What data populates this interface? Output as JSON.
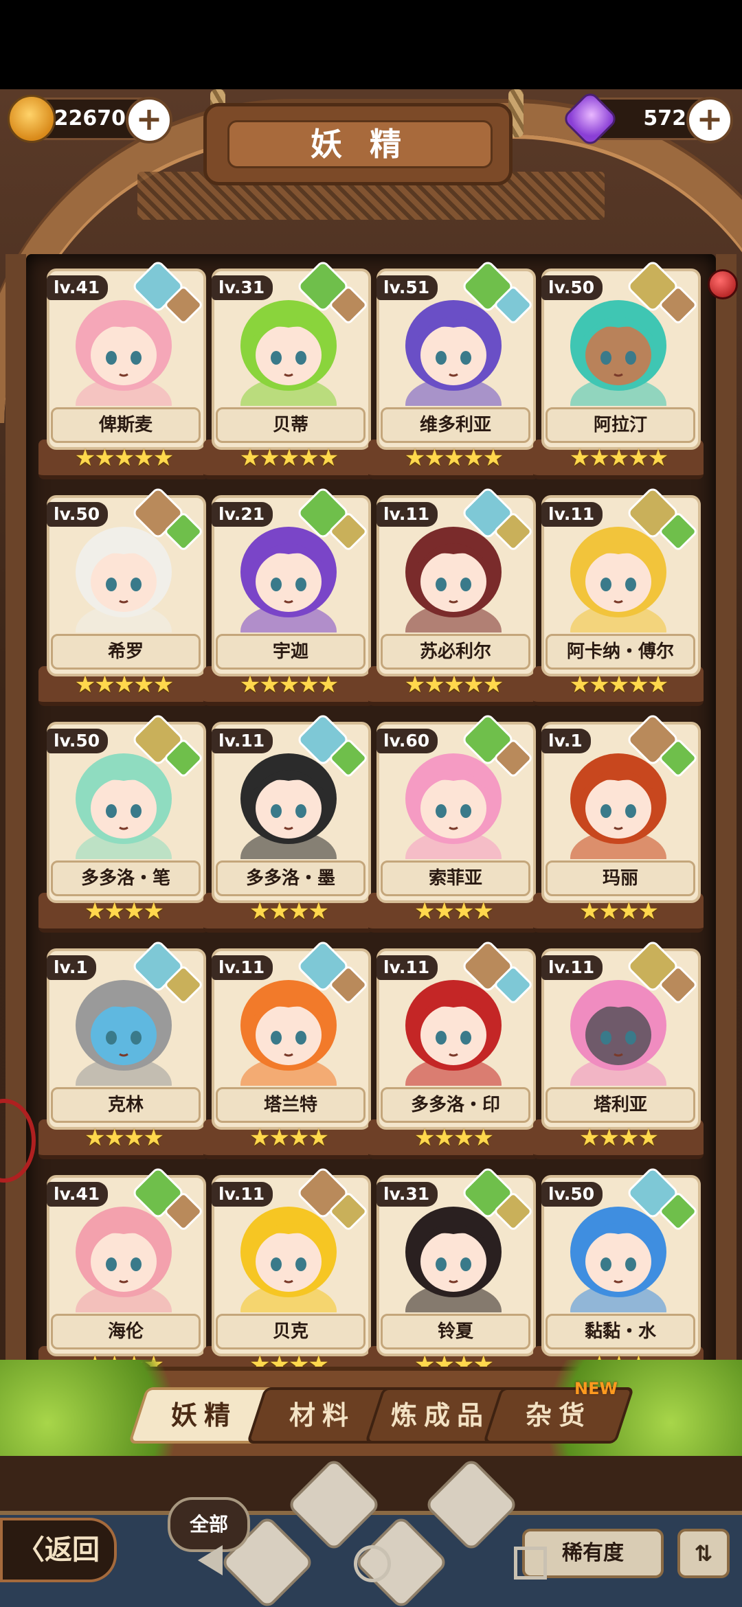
{
  "header": {
    "title": "妖 精",
    "coins": {
      "amount": "22670",
      "icon": "crown-coin-icon",
      "plus": "+"
    },
    "gems": {
      "amount": "572",
      "icon": "purple-gem-icon",
      "plus": "+"
    }
  },
  "elements": {
    "water": {
      "color": "#7ec8d6",
      "icon": "water-drop-icon"
    },
    "earth": {
      "color": "#b98a5b",
      "icon": "mountain-icon"
    },
    "plant": {
      "color": "#6fbf4b",
      "icon": "sprout-icon"
    },
    "sand": {
      "color": "#c9b05a",
      "icon": "pyramid-icon"
    }
  },
  "fairies": [
    {
      "lv": "lv.41",
      "name": "俾斯麦",
      "stars": "★★★★★",
      "e1": "water",
      "e2": "earth",
      "hair": "#f5a7b8",
      "skin": "#fde4d6"
    },
    {
      "lv": "lv.31",
      "name": "贝蒂",
      "stars": "★★★★★",
      "e1": "plant",
      "e2": "earth",
      "hair": "#8ad43c",
      "skin": "#fde4d6"
    },
    {
      "lv": "lv.51",
      "name": "维多利亚",
      "stars": "★★★★★",
      "e1": "plant",
      "e2": "water",
      "hair": "#6a4fc6",
      "skin": "#fde4d6"
    },
    {
      "lv": "lv.50",
      "name": "阿拉汀",
      "stars": "★★★★★",
      "e1": "sand",
      "e2": "earth",
      "hair": "#3fc6b3",
      "skin": "#b9825a"
    },
    {
      "lv": "lv.50",
      "name": "希罗",
      "stars": "★★★★★",
      "e1": "earth",
      "e2": "plant",
      "hair": "#f1efe9",
      "skin": "#fde4d6"
    },
    {
      "lv": "lv.21",
      "name": "宇迦",
      "stars": "★★★★★",
      "e1": "plant",
      "e2": "sand",
      "hair": "#7a45c8",
      "skin": "#fde4d6"
    },
    {
      "lv": "lv.11",
      "name": "苏必利尔",
      "stars": "★★★★★",
      "e1": "water",
      "e2": "sand",
      "hair": "#7a2b2b",
      "skin": "#fde4d6"
    },
    {
      "lv": "lv.11",
      "name": "阿卡纳・傅尔",
      "stars": "★★★★★",
      "e1": "sand",
      "e2": "plant",
      "hair": "#f2c43b",
      "skin": "#fde4d6"
    },
    {
      "lv": "lv.50",
      "name": "多多洛・笔",
      "stars": "★★★★",
      "e1": "sand",
      "e2": "plant",
      "hair": "#8fdcc0",
      "skin": "#fde4d6"
    },
    {
      "lv": "lv.11",
      "name": "多多洛・墨",
      "stars": "★★★★",
      "e1": "water",
      "e2": "plant",
      "hair": "#2b2b2b",
      "skin": "#fde4d6"
    },
    {
      "lv": "lv.60",
      "name": "索菲亚",
      "stars": "★★★★",
      "e1": "plant",
      "e2": "earth",
      "hair": "#f59bc3",
      "skin": "#fde4d6"
    },
    {
      "lv": "lv.1",
      "name": "玛丽",
      "stars": "★★★★",
      "e1": "earth",
      "e2": "plant",
      "hair": "#c8471e",
      "skin": "#fde4d6"
    },
    {
      "lv": "lv.1",
      "name": "克林",
      "stars": "★★★★",
      "e1": "water",
      "e2": "sand",
      "hair": "#9a9a9a",
      "skin": "#5fb8e0"
    },
    {
      "lv": "lv.11",
      "name": "塔兰特",
      "stars": "★★★★",
      "e1": "water",
      "e2": "earth",
      "hair": "#f27a2a",
      "skin": "#fde4d6"
    },
    {
      "lv": "lv.11",
      "name": "多多洛・印",
      "stars": "★★★★",
      "e1": "earth",
      "e2": "water",
      "hair": "#c42626",
      "skin": "#fde4d6"
    },
    {
      "lv": "lv.11",
      "name": "塔利亚",
      "stars": "★★★★",
      "e1": "sand",
      "e2": "earth",
      "hair": "#f08cc0",
      "skin": "#6f5a6a"
    },
    {
      "lv": "lv.41",
      "name": "海伦",
      "stars": "★★★★",
      "e1": "plant",
      "e2": "earth",
      "hair": "#f3a1ad",
      "skin": "#fde4d6"
    },
    {
      "lv": "lv.11",
      "name": "贝克",
      "stars": "★★★★",
      "e1": "earth",
      "e2": "sand",
      "hair": "#f6c623",
      "skin": "#fde4d6"
    },
    {
      "lv": "lv.31",
      "name": "铃夏",
      "stars": "★★★★",
      "e1": "plant",
      "e2": "sand",
      "hair": "#2a2020",
      "skin": "#fde4d6"
    },
    {
      "lv": "lv.50",
      "name": "黏黏・水",
      "stars": "★★★",
      "e1": "water",
      "e2": "plant",
      "hair": "#3f8ee0",
      "skin": "#fde4d6"
    }
  ],
  "tabs": [
    {
      "label": "妖精",
      "active": true
    },
    {
      "label": "材料",
      "active": false
    },
    {
      "label": "炼成品",
      "active": false
    },
    {
      "label": "杂货",
      "active": false
    }
  ],
  "tab_badge": "NEW",
  "bottom": {
    "back_label": "〈返回",
    "filter_all": "全部",
    "rarity_label": "稀有度",
    "sort_icon": "sort-icon"
  }
}
